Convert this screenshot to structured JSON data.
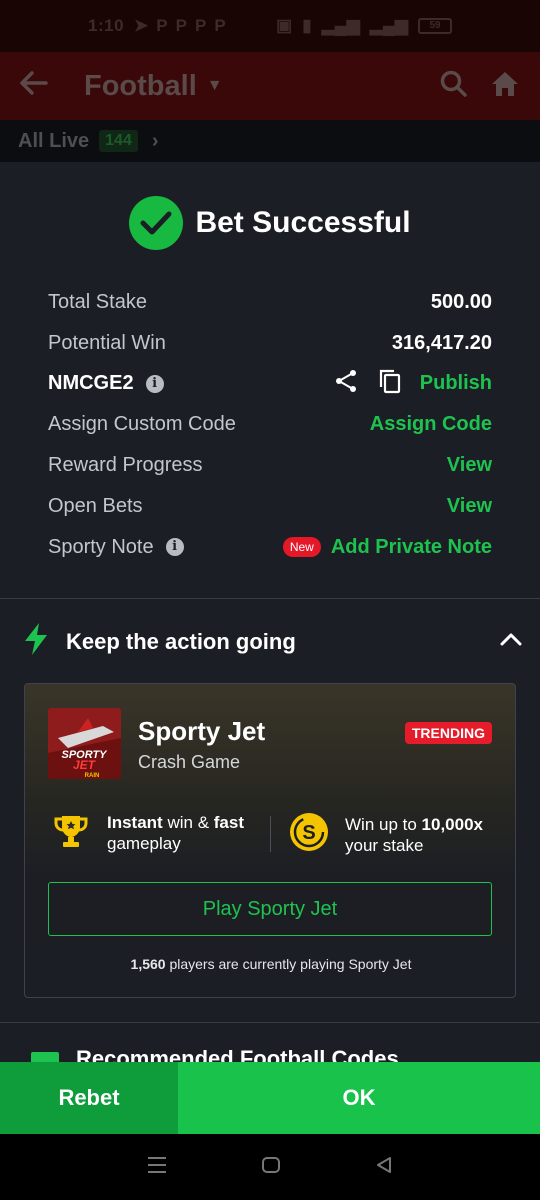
{
  "status_bar": {
    "time": "1:10",
    "app_icons": [
      "P",
      "P",
      "P",
      "P"
    ],
    "battery": "59"
  },
  "header": {
    "title": "Football"
  },
  "live_bar": {
    "label": "All Live",
    "count": "144"
  },
  "bet_result": {
    "title": "Bet Successful",
    "rows": [
      {
        "label": "Total Stake",
        "value": "500.00"
      },
      {
        "label": "Potential Win",
        "value": "316,417.20"
      }
    ],
    "booking_code": "NMCGE2",
    "publish_label": "Publish",
    "links": [
      {
        "label": "Assign Custom Code",
        "action": "Assign Code"
      },
      {
        "label": "Reward Progress",
        "action": "View"
      },
      {
        "label": "Open Bets",
        "action": "View"
      }
    ],
    "note": {
      "label": "Sporty Note",
      "badge": "New",
      "action": "Add Private Note"
    }
  },
  "promo_section": {
    "title": "Keep the action going",
    "game": {
      "name": "Sporty Jet",
      "subtitle": "Crash Game",
      "badge": "TRENDING",
      "thumb_text": "SPORTY",
      "thumb_text2": "JET",
      "thumb_text3": "RAIN",
      "feature1_bold1": "Instant",
      "feature1_text1": " win & ",
      "feature1_bold2": "fast",
      "feature1_text2": "gameplay",
      "feature2_text1": "Win up to ",
      "feature2_bold": "10,000x",
      "feature2_text2": "your stake",
      "play_label": "Play Sporty Jet",
      "players_count": "1,560",
      "players_text": " players are currently playing Sporty Jet"
    }
  },
  "recommended": {
    "title": "Recommended Football Codes"
  },
  "actions": {
    "rebet": "Rebet",
    "ok": "OK"
  },
  "colors": {
    "accent_green": "#1ec34f",
    "ok_green": "#19c24a",
    "rebet_green": "#0f9c3b",
    "badge_red": "#e41827"
  }
}
